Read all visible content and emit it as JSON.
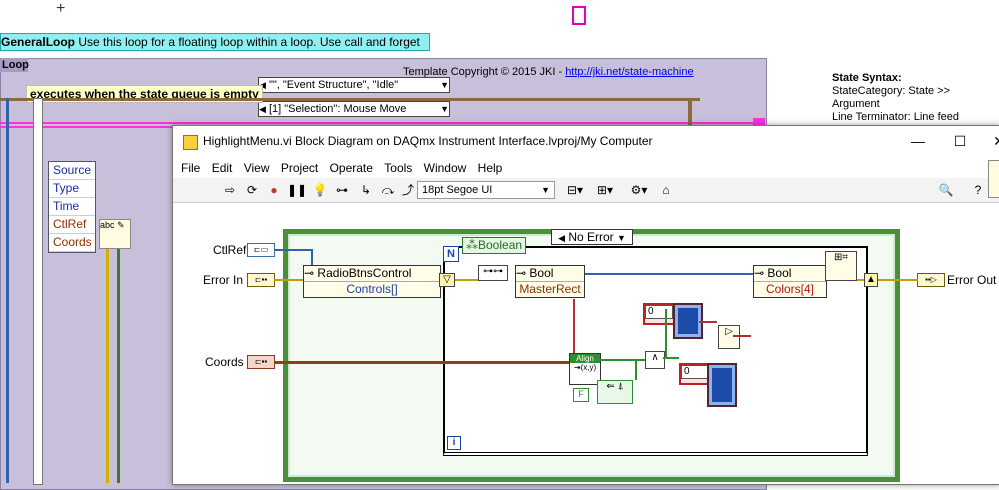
{
  "background": {
    "loop_banner": {
      "name": "GeneralLoop",
      "text": "Use this loop for a floating loop within a loop. Use call and forget"
    },
    "loop_tag": "Loop",
    "copyright": {
      "text": "Template Copyright © 2015 JKI - ",
      "link": "http://jki.net/state-machine"
    },
    "state_banner": "executes when the state queue is empty",
    "case_selector_1": "\"\", \"Event Structure\", \"Idle\"",
    "case_selector_2": "[1] \"Selection\": Mouse Move",
    "state_syntax": {
      "title": "State Syntax:",
      "lines": [
        "StateCategory: State >>",
        "Argument",
        "Line Terminator: Line feed"
      ]
    },
    "bundle_items": [
      "Source",
      "Type",
      "Time",
      "CtlRef",
      "Coords"
    ],
    "abc_label": "abc"
  },
  "window": {
    "title": "HighlightMenu.vi Block Diagram on DAQmx Instrument Interface.lvproj/My Computer",
    "menu": [
      "File",
      "Edit",
      "View",
      "Project",
      "Operate",
      "Tools",
      "Window",
      "Help"
    ],
    "font_select": "18pt Segoe UI",
    "case_label": "No Error",
    "inputs": {
      "ctlref": "CtlRef",
      "error_in": "Error In",
      "coords": "Coords"
    },
    "outputs": {
      "error_out": "Error Out"
    },
    "boolean_const": "Boolean",
    "nodes": {
      "radio": {
        "top": "RadioBtnsControl",
        "bottom": "Controls[]"
      },
      "bool1": {
        "top": "Bool",
        "bottom": "MasterRect"
      },
      "bool2": {
        "top": "Bool",
        "bottom": "Colors[4]"
      }
    },
    "align_label": "Align",
    "num_const_1": "0",
    "num_const_2": "0",
    "f_const": "F",
    "n_terminal": "N",
    "i_terminal": "i"
  },
  "colors": {
    "loop_banner_bg": "#8ff0ef",
    "loop_frame": "#c8c0da",
    "pink_wire": "#ff30e0",
    "error_wire": "#c2a000",
    "ref_wire": "#3163ad",
    "coords_wire": "#8b3f1a",
    "case_frame": "#4a8f3a"
  }
}
